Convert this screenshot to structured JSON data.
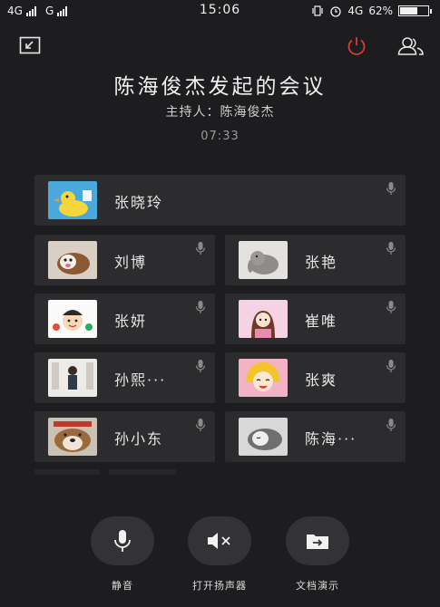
{
  "status_bar": {
    "network_left": "4G",
    "network_right": "G",
    "time": "15:06",
    "network_4g": "4G",
    "battery_percent": "62%",
    "battery_level": 0.62
  },
  "header": {
    "title": "陈海俊杰发起的会议",
    "host_label": "主持人：陈海俊杰",
    "timer": "07:33"
  },
  "participants": [
    {
      "name": "张晓玲",
      "avatar": "duck-avatar"
    },
    {
      "name": "刘博",
      "avatar": "dog-avatar"
    },
    {
      "name": "张艳",
      "avatar": "elephant-toy-avatar"
    },
    {
      "name": "张妍",
      "avatar": "cartoon-avatar"
    },
    {
      "name": "崔唯",
      "avatar": "girl-cartoon-avatar"
    },
    {
      "name": "孙熙···",
      "avatar": "person-avatar"
    },
    {
      "name": "张爽",
      "avatar": "anime-avatar"
    },
    {
      "name": "孙小东",
      "avatar": "dog-face-avatar"
    },
    {
      "name": "陈海···",
      "avatar": "sleeping-cat-avatar"
    }
  ],
  "controls": {
    "mute": "静音",
    "speaker": "打开扬声器",
    "share": "文档演示"
  },
  "colors": {
    "background": "#1d1d1f",
    "tile": "#2c2c2e",
    "hangup": "#e03a2f"
  }
}
